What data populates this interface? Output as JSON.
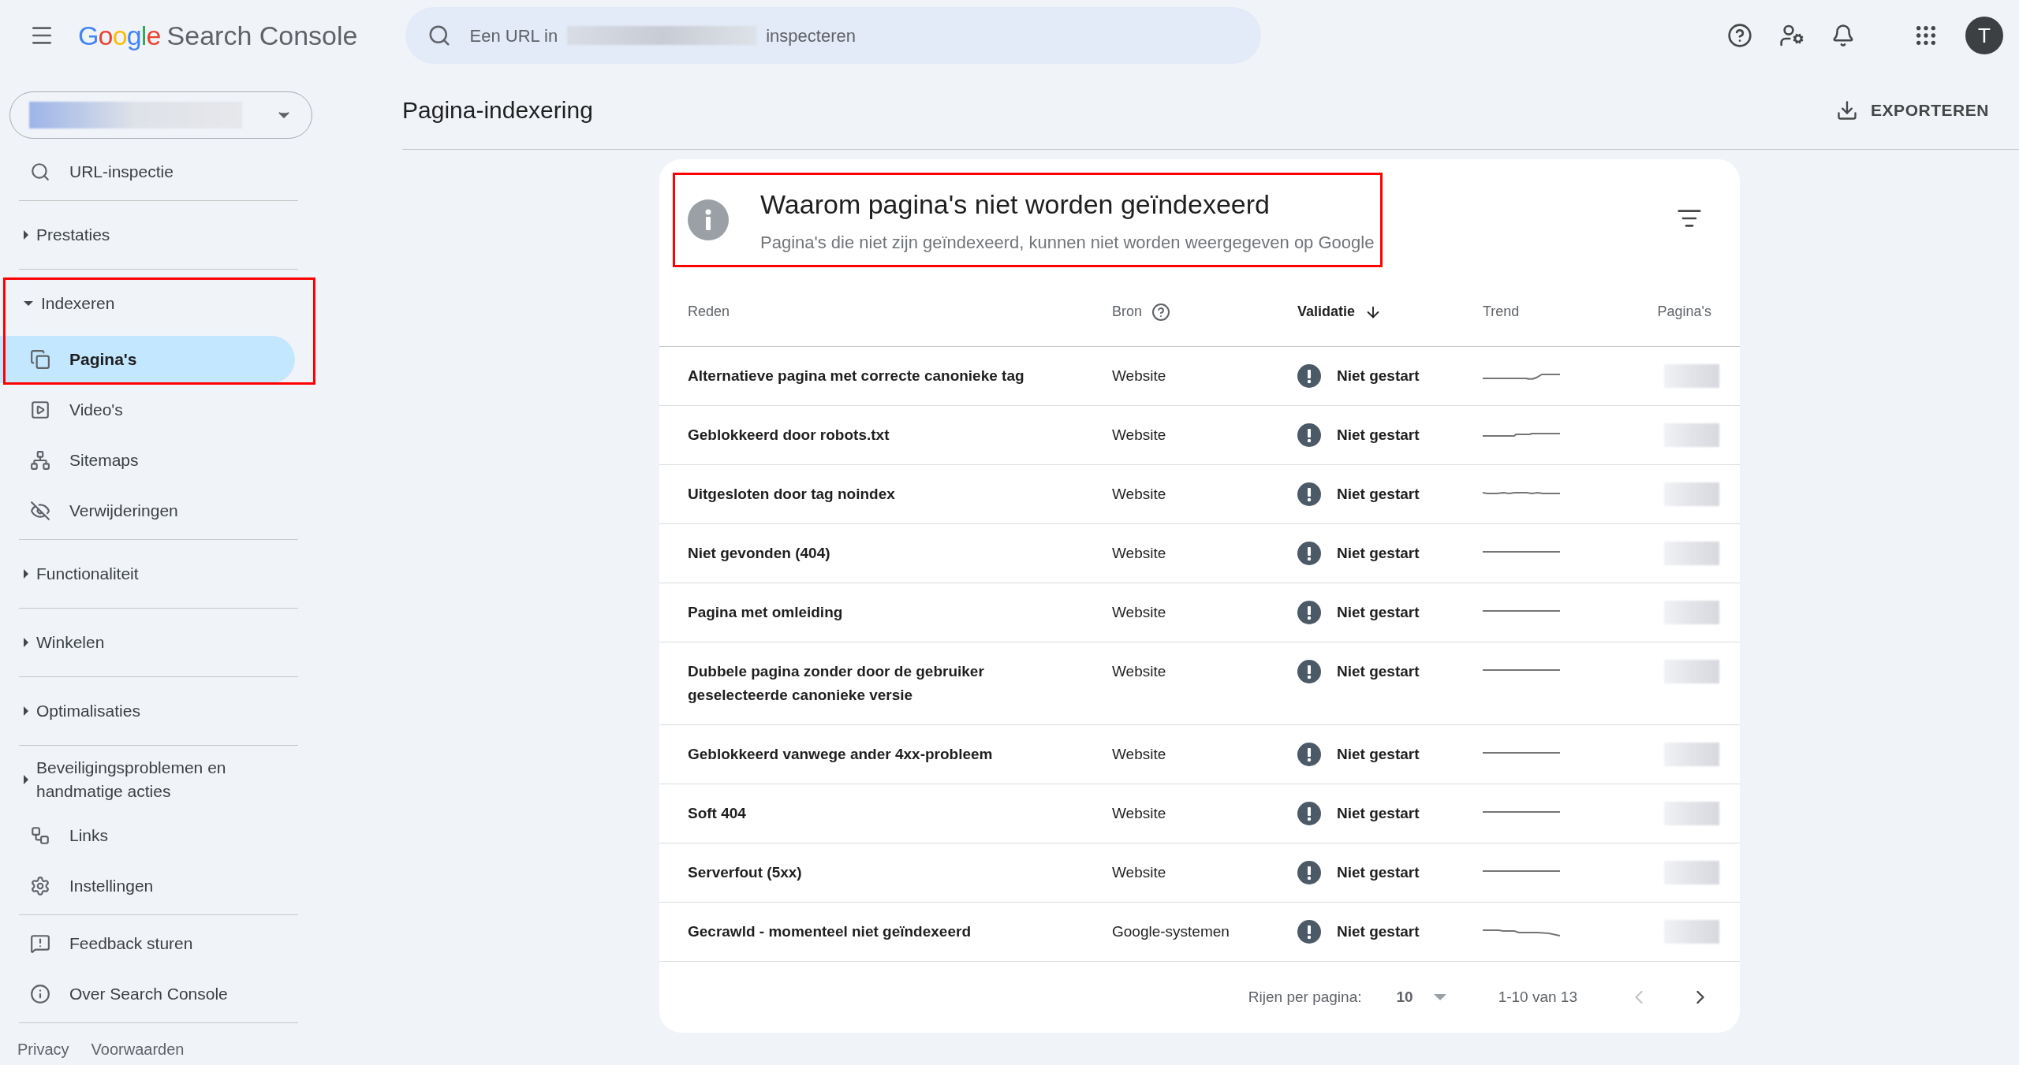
{
  "top_bar": {
    "logo": "Google",
    "product": "Search Console",
    "search": {
      "placeholder_start": "Een URL in",
      "placeholder_end": "inspecteren"
    },
    "avatar": "T"
  },
  "sidebar": {
    "sections": [
      [
        {
          "kind": "link",
          "label": "URL-inspectie",
          "selected": false
        }
      ],
      [
        {
          "kind": "group",
          "label": "Prestaties",
          "expanded": false,
          "highlighted": false
        }
      ],
      [
        {
          "kind": "group",
          "label": "Indexeren",
          "expanded": true,
          "highlighted": true,
          "children": [
            {
              "kind": "link",
              "label": "Pagina's",
              "selected": true
            },
            {
              "kind": "link",
              "label": "Video's",
              "selected": false
            },
            {
              "kind": "link",
              "label": "Sitemaps",
              "selected": false
            },
            {
              "kind": "link",
              "label": "Verwijderingen",
              "selected": false
            }
          ]
        }
      ],
      [
        {
          "kind": "group",
          "label": "Functionaliteit",
          "expanded": false,
          "highlighted": false
        }
      ],
      [
        {
          "kind": "group",
          "label": "Winkelen",
          "expanded": false,
          "highlighted": false
        }
      ],
      [
        {
          "kind": "group",
          "label": "Optimalisaties",
          "expanded": false,
          "highlighted": false
        }
      ],
      [
        {
          "kind": "group",
          "label": "Beveiligingsproblemen en handmatige acties",
          "expanded": false,
          "highlighted": false
        },
        {
          "kind": "link",
          "label": "Links",
          "selected": false
        },
        {
          "kind": "link",
          "label": "Instellingen",
          "selected": false
        }
      ],
      [
        {
          "kind": "link",
          "label": "Feedback sturen",
          "selected": false
        },
        {
          "kind": "link",
          "label": "Over Search Console",
          "selected": false
        }
      ]
    ],
    "footer_links": [
      "Privacy",
      "Voorwaarden"
    ]
  },
  "page": {
    "title": "Pagina-indexering",
    "export_button": "EXPORTEREN"
  },
  "card": {
    "title": "Waarom pagina's niet worden geïndexeerd",
    "subtitle": "Pagina's die niet zijn geïndexeerd, kunnen niet worden weergegeven op Google",
    "highlighted": true
  },
  "table": {
    "columns": [
      {
        "label": "Reden",
        "sorted": false
      },
      {
        "label": "Bron",
        "sorted": false
      },
      {
        "label": "Validatie",
        "sorted": true
      },
      {
        "label": "Trend",
        "sorted": false
      },
      {
        "label": "Pagina's",
        "sorted": false
      }
    ],
    "rows": [
      {
        "reason": "Alternatieve pagina met correcte canonieke tag",
        "source": "Website",
        "validation": "Niet gestart"
      },
      {
        "reason": "Geblokkeerd door robots.txt",
        "source": "Website",
        "validation": "Niet gestart"
      },
      {
        "reason": "Uitgesloten door tag noindex",
        "source": "Website",
        "validation": "Niet gestart"
      },
      {
        "reason": "Niet gevonden (404)",
        "source": "Website",
        "validation": "Niet gestart"
      },
      {
        "reason": "Pagina met omleiding",
        "source": "Website",
        "validation": "Niet gestart"
      },
      {
        "reason": "Dubbele pagina zonder door de gebruiker geselecteerde canonieke versie",
        "source": "Website",
        "validation": "Niet gestart"
      },
      {
        "reason": "Geblokkeerd vanwege ander 4xx-probleem",
        "source": "Website",
        "validation": "Niet gestart"
      },
      {
        "reason": "Soft 404",
        "source": "Website",
        "validation": "Niet gestart"
      },
      {
        "reason": "Serverfout (5xx)",
        "source": "Website",
        "validation": "Niet gestart"
      },
      {
        "reason": "Gecrawld - momenteel niet geïndexeerd",
        "source": "Google-systemen",
        "validation": "Niet gestart"
      }
    ]
  },
  "pagination": {
    "rows_label": "Rijen per pagina:",
    "rows_value": "10",
    "range": "1-10 van 13",
    "previous_disabled": true,
    "next_disabled": false
  }
}
